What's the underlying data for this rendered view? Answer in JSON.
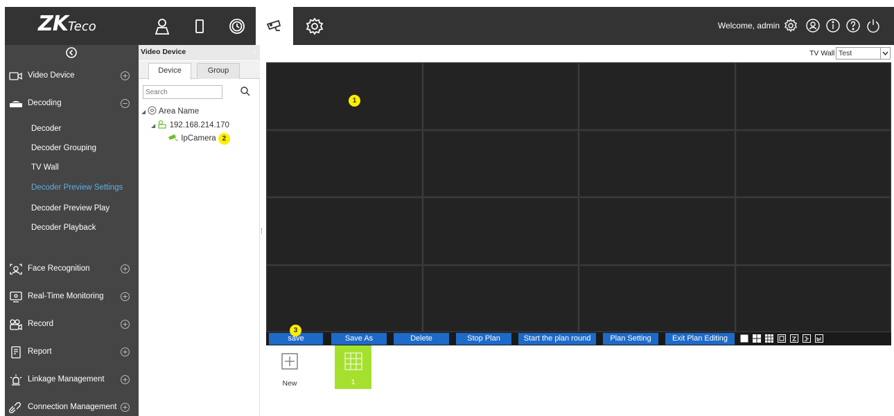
{
  "header": {
    "logo_main": "ZK",
    "logo_tail": "Teco",
    "welcome": "Welcome, admin",
    "nav_icons": [
      "person-icon",
      "door-icon",
      "clock-icon",
      "camera-icon",
      "gear-icon"
    ],
    "active_nav": "camera-icon",
    "right_icons": [
      "settings-icon",
      "user-icon",
      "info-icon",
      "help-icon",
      "power-icon"
    ]
  },
  "sidebar": {
    "sections": [
      {
        "label": "Video Device",
        "icon": "video-device-icon",
        "state": "plus"
      },
      {
        "label": "Decoding",
        "icon": "decoder-icon",
        "state": "minus"
      },
      {
        "label": "Face Recognition",
        "icon": "face-icon",
        "state": "plus"
      },
      {
        "label": "Real-Time Monitoring",
        "icon": "monitor-icon",
        "state": "plus"
      },
      {
        "label": "Record",
        "icon": "record-icon",
        "state": "plus"
      },
      {
        "label": "Report",
        "icon": "report-icon",
        "state": "plus"
      },
      {
        "label": "Linkage Management",
        "icon": "linkage-icon",
        "state": "plus"
      },
      {
        "label": "Connection Management",
        "icon": "connection-icon",
        "state": "plus"
      }
    ],
    "decoding_items": [
      {
        "label": "Decoder",
        "active": false
      },
      {
        "label": "Decoder Grouping",
        "active": false
      },
      {
        "label": "TV Wall",
        "active": false
      },
      {
        "label": "Decoder Preview Settings",
        "active": true
      },
      {
        "label": "Decoder Preview Play",
        "active": false
      },
      {
        "label": "Decoder Playback",
        "active": false
      }
    ]
  },
  "device_panel": {
    "title": "Video Device",
    "tabs": [
      "Device",
      "Group"
    ],
    "active_tab": "Device",
    "search_placeholder": "Search",
    "tree": {
      "area": "Area Name",
      "device": "192.168.214.170",
      "camera": "IpCamera"
    }
  },
  "main": {
    "tvwall_label": "TV Wall",
    "tvwall_value": "Test",
    "callouts": [
      "1",
      "2",
      "3"
    ],
    "toolbar": [
      "save",
      "Save As",
      "Delete",
      "Stop Plan",
      "Start the plan round",
      "Plan Setting",
      "Exit Plan Editing"
    ],
    "layouts": [
      "1",
      "4",
      "9",
      "16",
      "25",
      "36",
      "64"
    ],
    "plans": {
      "new_label": "New",
      "plan_label": "1"
    }
  },
  "colors": {
    "topbar": "#333333",
    "sidebar": "#454545",
    "active_link": "#5fb0e8",
    "toolbar_button": "#1e6ac8",
    "plan_selected": "#a6e02e",
    "callout": "#ffee00"
  }
}
